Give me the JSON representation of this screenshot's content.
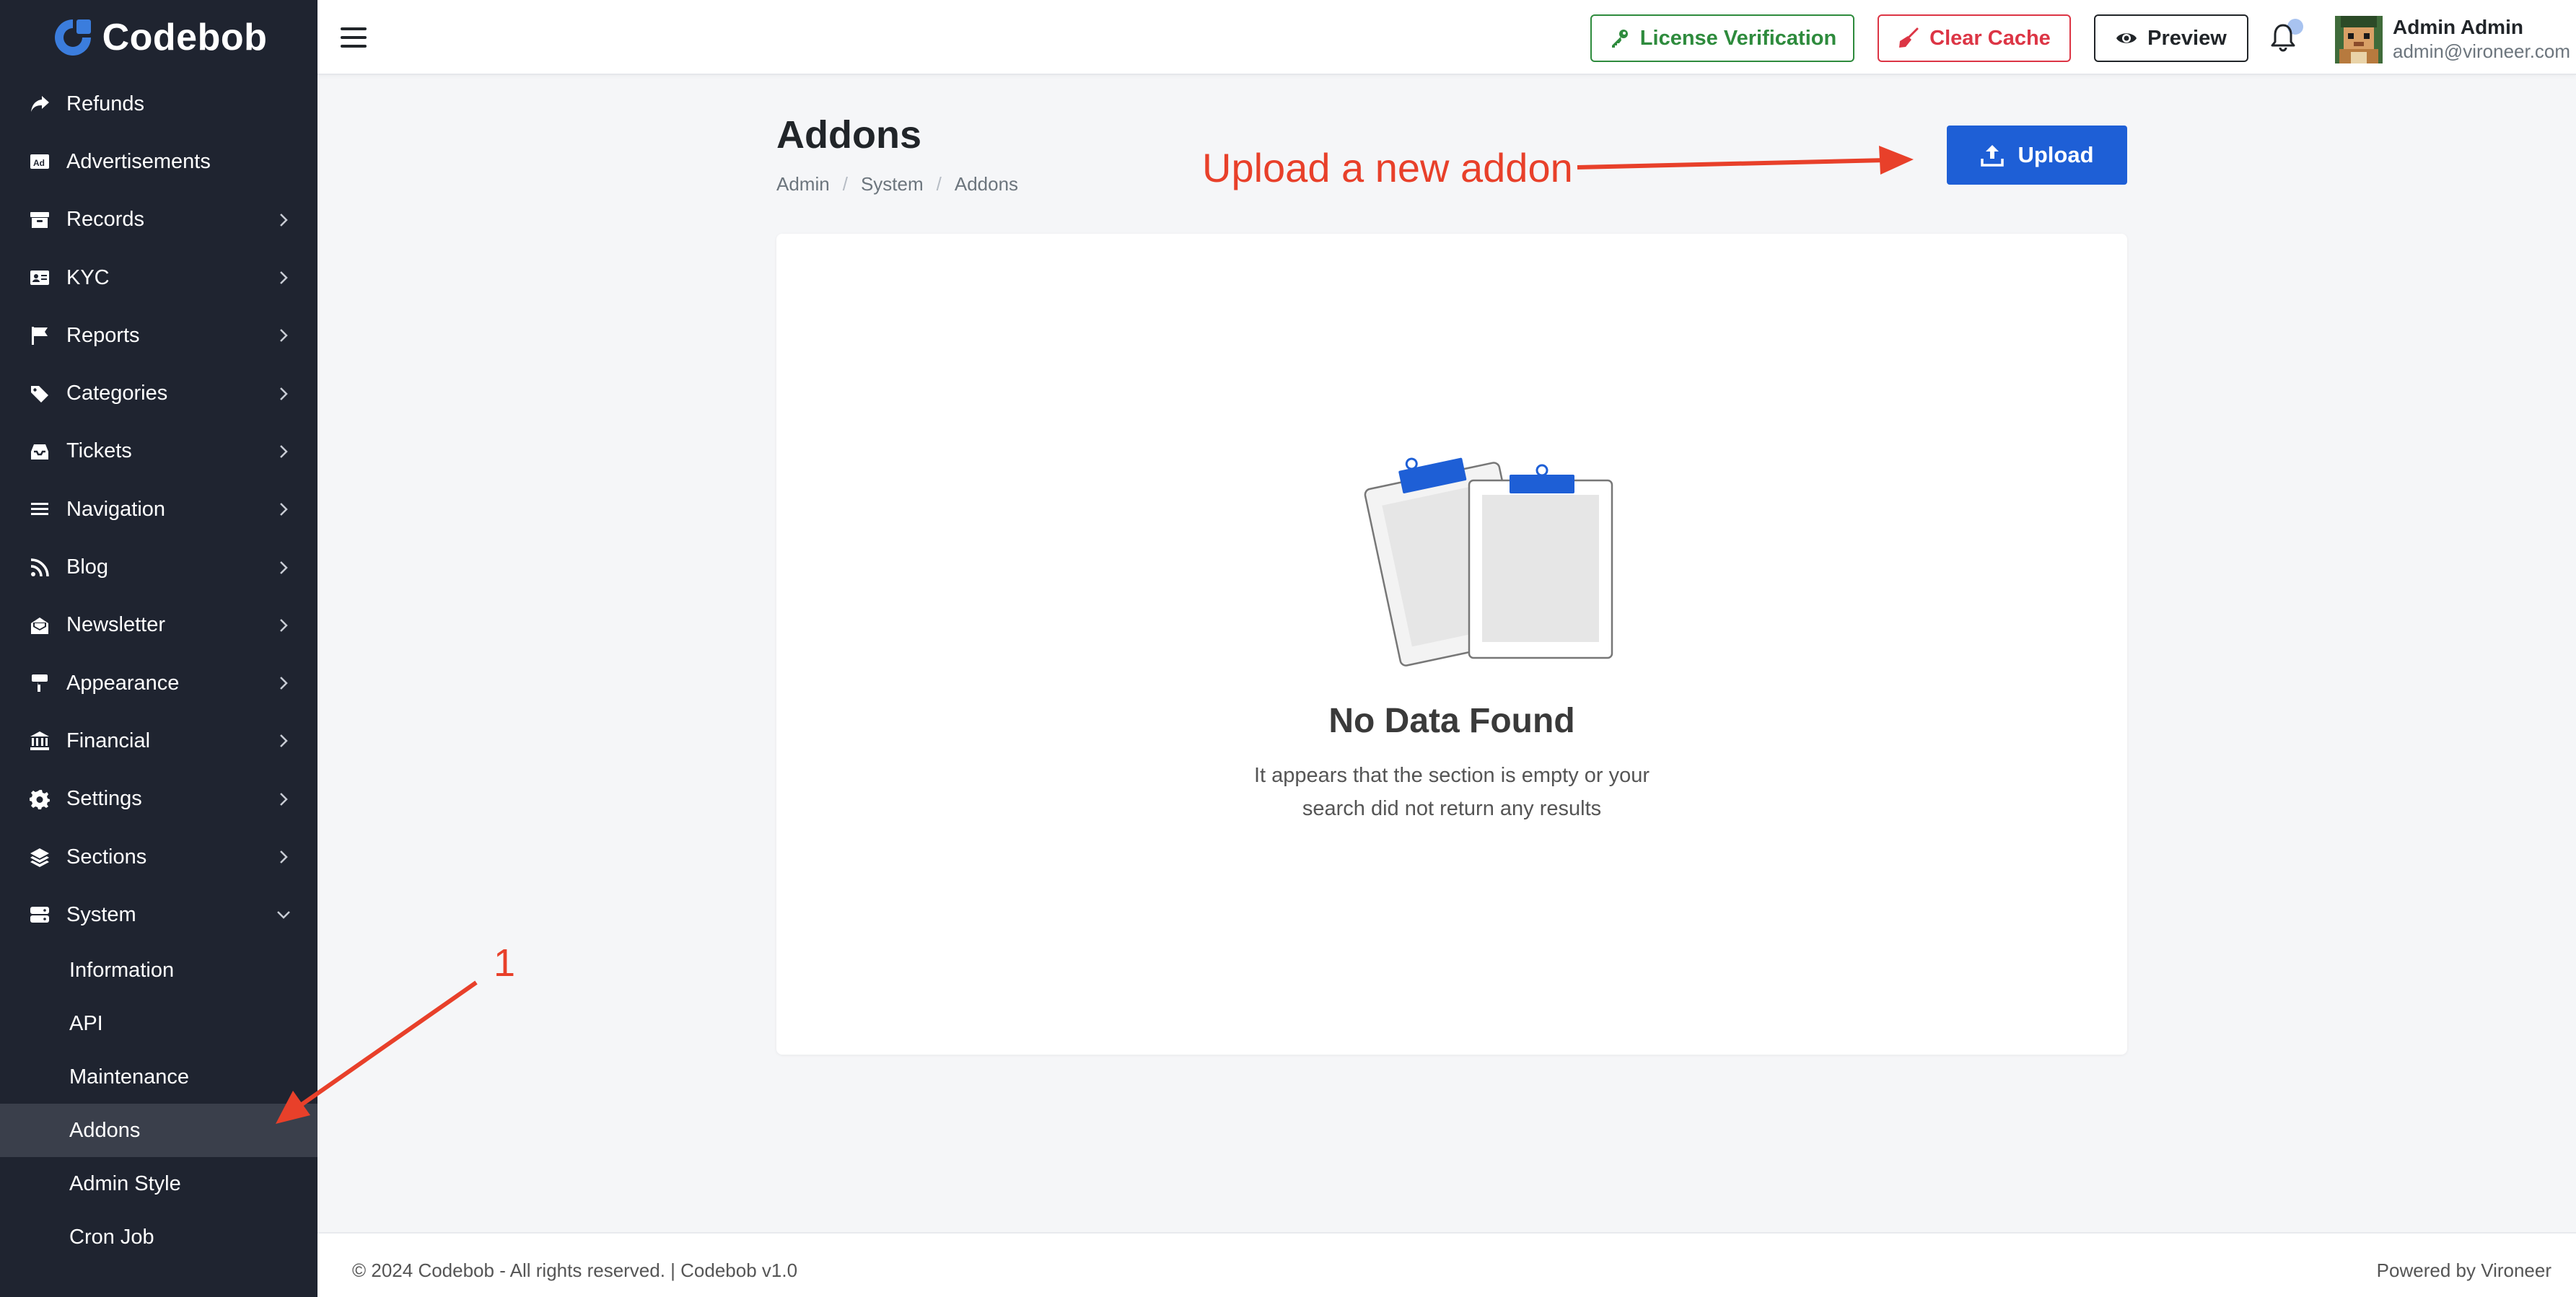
{
  "brand": {
    "name": "Codebob"
  },
  "sidebar": {
    "items": [
      {
        "label": "Refunds",
        "icon": "share-icon",
        "chevron": false
      },
      {
        "label": "Advertisements",
        "icon": "ad-icon",
        "chevron": false
      },
      {
        "label": "Records",
        "icon": "archive-icon",
        "chevron": true
      },
      {
        "label": "KYC",
        "icon": "id-card-icon",
        "chevron": true
      },
      {
        "label": "Reports",
        "icon": "flag-icon",
        "chevron": true
      },
      {
        "label": "Categories",
        "icon": "tags-icon",
        "chevron": true
      },
      {
        "label": "Tickets",
        "icon": "inbox-icon",
        "chevron": true
      },
      {
        "label": "Navigation",
        "icon": "bars-icon",
        "chevron": true
      },
      {
        "label": "Blog",
        "icon": "rss-icon",
        "chevron": true
      },
      {
        "label": "Newsletter",
        "icon": "envelope-open-icon",
        "chevron": true
      },
      {
        "label": "Appearance",
        "icon": "paint-roller-icon",
        "chevron": true
      },
      {
        "label": "Financial",
        "icon": "bank-icon",
        "chevron": true
      },
      {
        "label": "Settings",
        "icon": "gear-icon",
        "chevron": true
      },
      {
        "label": "Sections",
        "icon": "layers-icon",
        "chevron": true
      },
      {
        "label": "System",
        "icon": "server-icon",
        "chevron": true,
        "expanded": true
      }
    ],
    "system_sub": [
      {
        "label": "Information",
        "active": false
      },
      {
        "label": "API",
        "active": false
      },
      {
        "label": "Maintenance",
        "active": false
      },
      {
        "label": "Addons",
        "active": true
      },
      {
        "label": "Admin Style",
        "active": false
      },
      {
        "label": "Cron Job",
        "active": false
      }
    ]
  },
  "topbar": {
    "license_label": "License Verification",
    "cache_label": "Clear Cache",
    "preview_label": "Preview",
    "user_name": "Admin Admin",
    "user_email": "admin@vironeer.com"
  },
  "page": {
    "title": "Addons",
    "breadcrumb": [
      "Admin",
      "System",
      "Addons"
    ],
    "upload_label": "Upload"
  },
  "empty_state": {
    "title": "No Data Found",
    "line1": "It appears that the section is empty or your",
    "line2": "search did not return any results"
  },
  "annotations": {
    "upload_hint": "Upload a new addon",
    "step_number": "1"
  },
  "footer": {
    "copyright": "© 2024 Codebob - All rights reserved. | Codebob v1.0",
    "powered": "Powered by Vironeer"
  },
  "colors": {
    "sidebar_bg": "#1f2430",
    "primary": "#1e5fd6",
    "success": "#2e8b3d",
    "danger": "#dc3545",
    "annotation": "#e8402a"
  }
}
